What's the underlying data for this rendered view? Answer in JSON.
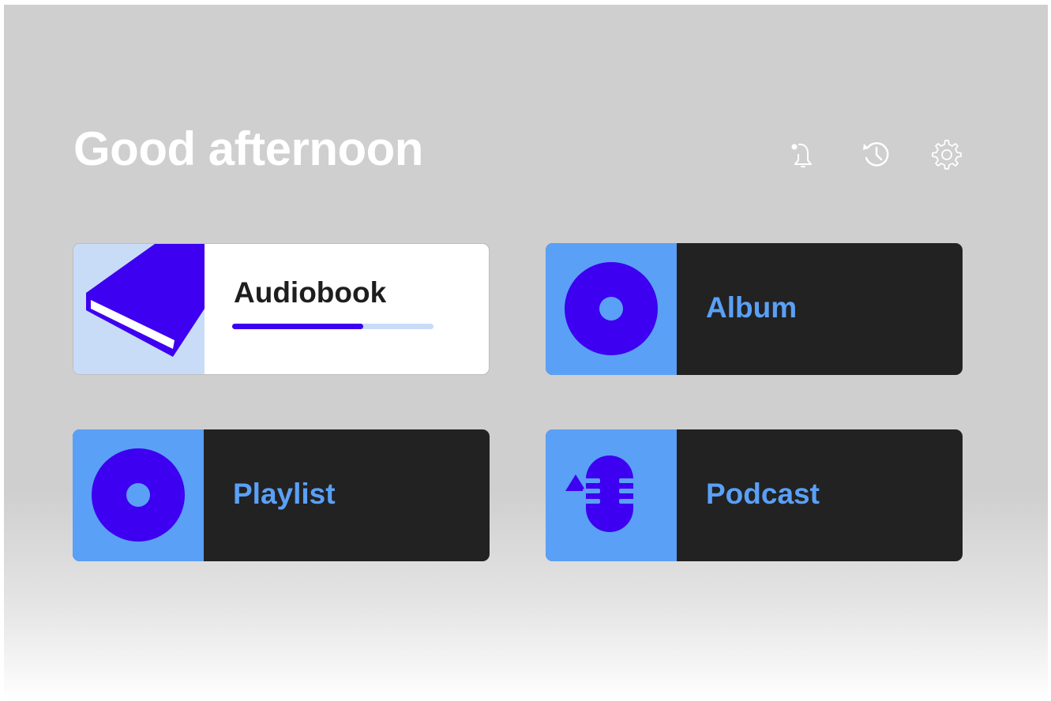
{
  "colors": {
    "accent": "#3d00f0",
    "art_blue": "#5aa0f6",
    "art_light": "#c8dcf8",
    "card_dark": "#222222",
    "background": "#cfcfcf"
  },
  "header": {
    "greeting": "Good afternoon",
    "icons": [
      "notification-bell-icon",
      "history-icon",
      "settings-gear-icon"
    ]
  },
  "cards": [
    {
      "label": "Audiobook",
      "icon": "book-icon",
      "progress": 0.65
    },
    {
      "label": "Album",
      "icon": "disc-icon"
    },
    {
      "label": "Playlist",
      "icon": "disc-icon"
    },
    {
      "label": "Podcast",
      "icon": "microphone-icon"
    }
  ]
}
